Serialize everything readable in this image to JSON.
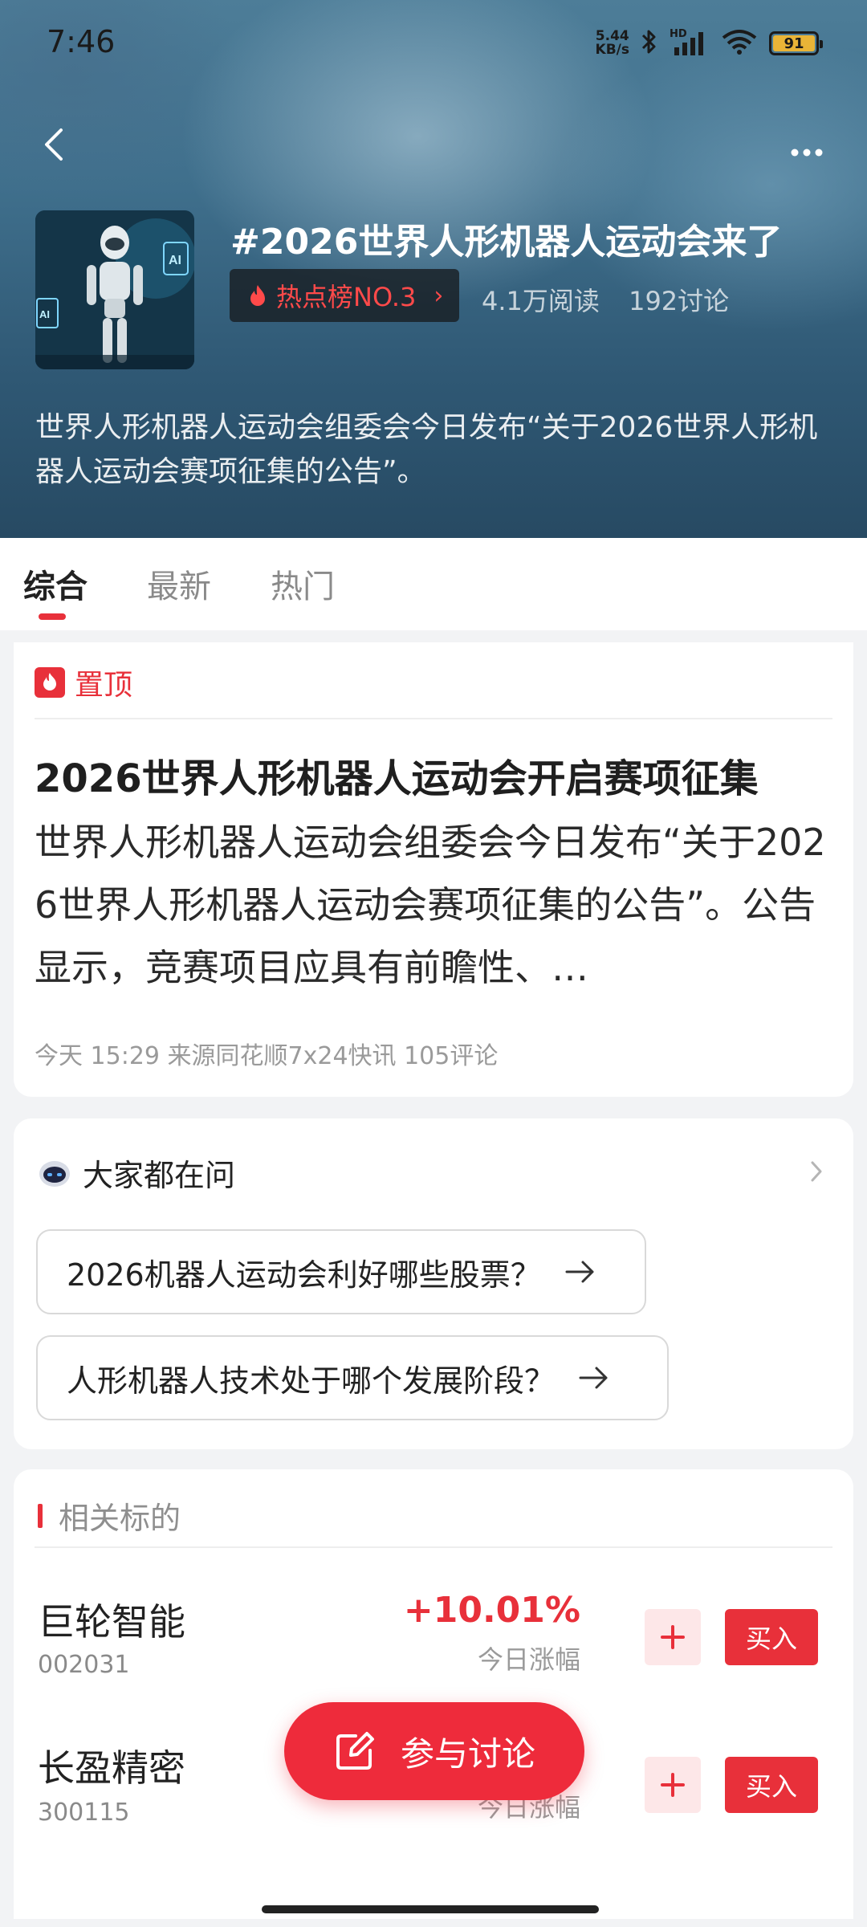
{
  "status_bar": {
    "time": "7:46",
    "net_speed_value": "5.44",
    "net_speed_unit": "KB/s",
    "battery": "91",
    "network_label": "HD"
  },
  "header": {
    "title": "#2026世界人形机器人运动会来了",
    "hot_badge": "热点榜NO.3",
    "reads": "4.1万阅读",
    "discussions": "192讨论",
    "description": "世界人形机器人运动会组委会今日发布“关于2026世界人形机器人运动会赛项征集的公告”。"
  },
  "tabs": [
    {
      "label": "综合"
    },
    {
      "label": "最新"
    },
    {
      "label": "热门"
    }
  ],
  "pinned": {
    "label": "置顶",
    "title": "2026世界人形机器人运动会开启赛项征集",
    "summary": "世界人形机器人运动会组委会今日发布“关于2026世界人形机器人运动会赛项征集的公告”。公告显示，竞赛项目应具有前瞻性、…",
    "meta": "今天 15:29 来源同花顺7x24快讯 105评论"
  },
  "ask": {
    "title": "大家都在问",
    "questions": [
      "2026机器人运动会利好哪些股票？",
      "人形机器人技术处于哪个发展阶段？"
    ]
  },
  "related": {
    "title": "相关标的",
    "stocks": [
      {
        "name": "巨轮智能",
        "code": "002031",
        "change": "+10.01%",
        "change_label": "今日涨幅",
        "buy": "买入"
      },
      {
        "name": "长盈精密",
        "code": "300115",
        "change": "",
        "change_label": "今日涨幅",
        "buy": "买入"
      }
    ]
  },
  "fab": {
    "label": "参与讨论"
  },
  "colors": {
    "accent": "#e8303a",
    "fab": "#ee2b3b"
  }
}
